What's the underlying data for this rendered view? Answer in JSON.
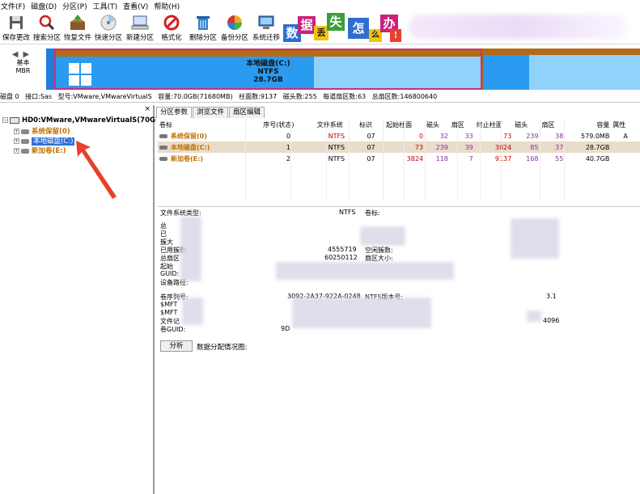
{
  "menu": {
    "items": [
      "文件(F)",
      "磁盘(D)",
      "分区(P)",
      "工具(T)",
      "查看(V)",
      "帮助(H)"
    ]
  },
  "toolbar": {
    "buttons": [
      {
        "label": "保存更改",
        "icon": "save-icon"
      },
      {
        "label": "搜索分区",
        "icon": "search-icon"
      },
      {
        "label": "恢复文件",
        "icon": "recover-icon"
      },
      {
        "label": "快速分区",
        "icon": "quick-partition-icon"
      },
      {
        "label": "新建分区",
        "icon": "new-partition-icon"
      },
      {
        "label": "格式化",
        "icon": "format-icon"
      },
      {
        "label": "删除分区",
        "icon": "delete-icon"
      },
      {
        "label": "备份分区",
        "icon": "backup-icon"
      },
      {
        "label": "系统迁移",
        "icon": "migrate-icon"
      }
    ],
    "ad_tiles": [
      "数",
      "据",
      "丢",
      "失",
      "怎",
      "么",
      "办",
      "!"
    ]
  },
  "diskmap": {
    "disk_type": "基本",
    "disk_style": "MBR",
    "partition_name": "本地磁盘(C:)",
    "partition_fs": "NTFS",
    "partition_size": "28.7GB"
  },
  "infoline": {
    "disk": "磁盘 0",
    "interface": "接口:Sas",
    "model": "型号:VMware,VMwareVirtualS",
    "capacity": "容量:70.0GB(71680MB)",
    "cylinders": "柱面数:9137",
    "heads": "磁头数:255",
    "sectors_per_track": "每道扇区数:63",
    "total_sectors": "总扇区数:146800640"
  },
  "tree": {
    "close": "×",
    "disk": "HD0:VMware,VMwareVirtualS(70GB)",
    "items": [
      "系统保留(0)",
      "本地磁盘(C:)",
      "新加卷(E:)"
    ]
  },
  "tabs": [
    "分区参数",
    "浏览文件",
    "扇区编辑"
  ],
  "table": {
    "headers": [
      "卷标",
      "序号(状态)",
      "文件系统",
      "标识",
      "起始柱面",
      "磁头",
      "扇区",
      "终止柱面",
      "磁头",
      "扇区",
      "容量",
      "属性"
    ],
    "rows": [
      [
        "系统保留(0)",
        "0",
        "NTFS",
        "07",
        "0",
        "32",
        "33",
        "73",
        "239",
        "38",
        "579.0MB",
        "A"
      ],
      [
        "本地磁盘(C:)",
        "1",
        "NTFS",
        "07",
        "73",
        "239",
        "39",
        "3824",
        "85",
        "37",
        "28.7GB",
        ""
      ],
      [
        "新加卷(E:)",
        "2",
        "NTFS",
        "07",
        "3824",
        "118",
        "7",
        "9137",
        "168",
        "55",
        "40.7GB",
        ""
      ]
    ]
  },
  "detail": {
    "fs_type_label": "文件系统类型:",
    "fs_type_value": "NTFS",
    "volume_label": "卷标:",
    "line2": "总",
    "line3": "已",
    "line4": "簇大",
    "used_clusters": "已用簇数:",
    "used_value": "4555719",
    "free_clusters": "空闲簇数:",
    "total_sectors": "总扇区",
    "total_value": "60250112",
    "sector_size": "扇区大小:",
    "start_sector": "起始",
    "guid": "GUID:",
    "device_path": "设备路径:",
    "serial_label": "卷序列号:",
    "serial_value": "3092-2A37-922A-0248",
    "ntfs_ver_label": "NTFS版本号:",
    "ntfs_ver_value": "3.1",
    "mft1": "$MFT",
    "mft2": "$MFT",
    "file_record": "文件记",
    "file_record_value": "4096",
    "vol_guid": "卷GUID:",
    "vol_guid_value": "9D"
  },
  "analyze": {
    "button": "分析",
    "label": "数据分配情况图:"
  },
  "colors": {
    "orange_bar": "#b56a18",
    "partition_blue": "#2a9bf0",
    "partition_light": "#8fd2fa",
    "selected_border": "#cc2f7a",
    "highlight_row": "#e9dccb",
    "red_text": "#c00000",
    "purple_text": "#8a2da0",
    "arrow_red": "#e8402a"
  }
}
